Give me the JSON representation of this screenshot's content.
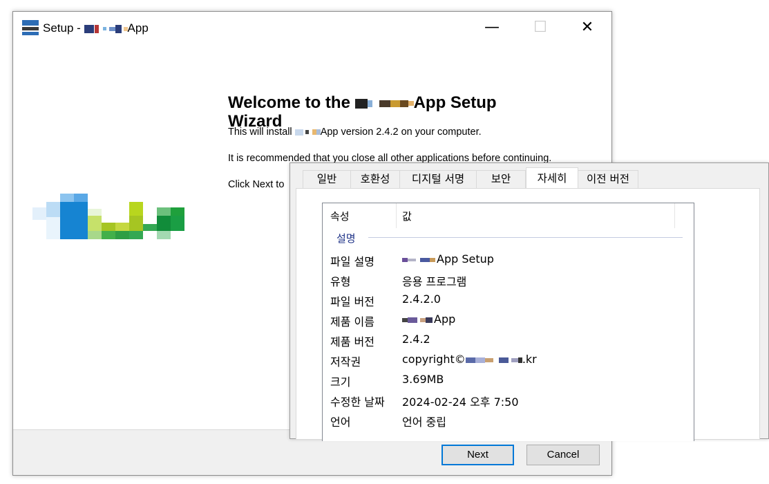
{
  "setup": {
    "title_prefix": "Setup - ",
    "title_suffix": "App",
    "window_controls": {
      "minimize": "—",
      "maximize": "☐",
      "close": "✕"
    },
    "welcome_title_line1_prefix": "Welcome to the ",
    "welcome_title_line1_suffix": "App Setup",
    "welcome_title_line2": "Wizard",
    "install_prefix": "This will install ",
    "install_suffix": "App version 2.4.2 on your computer.",
    "recommend_text": "It is recommended that you close all other applications before continuing.",
    "click_next_text": "Click Next to",
    "next_label": "Next",
    "cancel_label": "Cancel",
    "colors": {
      "accent": "#0078d7",
      "logo_blue": "#1e87d2",
      "logo_green": "#8bc34a",
      "logo_dark_green": "#128a3c"
    }
  },
  "properties": {
    "tabs": [
      {
        "label": "일반"
      },
      {
        "label": "호환성"
      },
      {
        "label": "디지털 서명"
      },
      {
        "label": "보안"
      },
      {
        "label": "자세히"
      },
      {
        "label": "이전 버전"
      }
    ],
    "active_tab": "자세히",
    "columns": {
      "property": "속성",
      "value": "값"
    },
    "group": "설명",
    "rows": [
      {
        "key": "파일 설명",
        "value": "App Setup"
      },
      {
        "key": "유형",
        "value": "응용 프로그램"
      },
      {
        "key": "파일 버전",
        "value": "2.4.2.0"
      },
      {
        "key": "제품 이름",
        "value": "App"
      },
      {
        "key": "제품 버전",
        "value": "2.4.2"
      },
      {
        "key": "저작권",
        "value_prefix": "copyright©",
        "value_suffix": ".kr"
      },
      {
        "key": "크기",
        "value": "3.69MB"
      },
      {
        "key": "수정한 날짜",
        "value": "2024-02-24 오후 7:50"
      },
      {
        "key": "언어",
        "value": "언어 중립"
      }
    ]
  }
}
